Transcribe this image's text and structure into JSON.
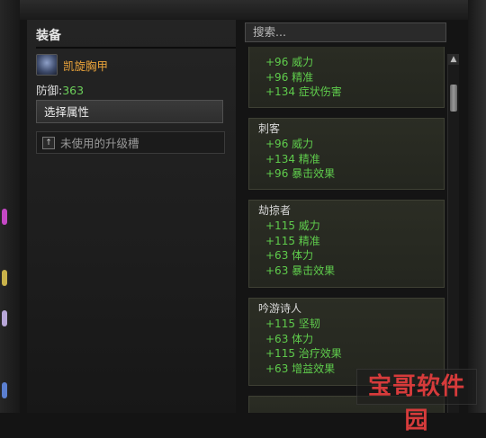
{
  "equipment": {
    "title": "装备",
    "item_name": "凯旋胸甲",
    "defense_label": "防御:",
    "defense_value": "363",
    "select_stats_button": "选择属性",
    "upgrade_slot_label": "未使用的升级槽"
  },
  "search": {
    "placeholder": "搜索..."
  },
  "stat_cards": [
    {
      "title": "",
      "stats": [
        "+96 威力",
        "+96 精准",
        "+134 症状伤害"
      ]
    },
    {
      "title": "刺客",
      "stats": [
        "+96 威力",
        "+134 精准",
        "+96 暴击效果"
      ]
    },
    {
      "title": "劫掠者",
      "stats": [
        "+115 威力",
        "+115 精准",
        "+63 体力",
        "+63 暴击效果"
      ]
    },
    {
      "title": "吟游诗人",
      "stats": [
        "+115 坚韧",
        "+63 体力",
        "+115 治疗效果",
        "+63 增益效果"
      ]
    },
    {
      "title": "",
      "stats": []
    }
  ],
  "watermark": {
    "text": "宝哥软件园"
  },
  "colors": {
    "item_name": "#e8a23a",
    "stat_green": "#5fcc4c",
    "watermark": "#d63b3b"
  }
}
